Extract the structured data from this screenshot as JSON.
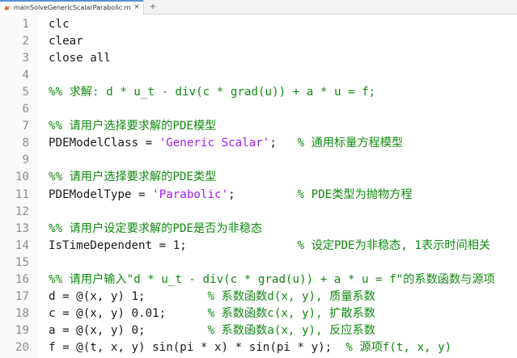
{
  "tab": {
    "title": "mainSolveGenericScalarParabolic.m",
    "close_glyph": "×",
    "add_glyph": "+"
  },
  "colors": {
    "comment": "#128a12",
    "string": "#a020f0",
    "text": "#1a1a1a",
    "line_number": "#8c8c8c",
    "tab_accent": "#5b8fd6"
  },
  "icons": {
    "file": "matlab-file-icon"
  },
  "lines": [
    {
      "num": "1",
      "code": "clc",
      "string": "",
      "rest": "",
      "comment": ""
    },
    {
      "num": "2",
      "code": "clear",
      "string": "",
      "rest": "",
      "comment": ""
    },
    {
      "num": "3",
      "code": "close all",
      "string": "",
      "rest": "",
      "comment": ""
    },
    {
      "num": "4",
      "code": "",
      "string": "",
      "rest": "",
      "comment": ""
    },
    {
      "num": "5",
      "code": "",
      "string": "",
      "rest": "",
      "comment": "%% 求解: d * u_t - div(c * grad(u)) + a * u = f;"
    },
    {
      "num": "6",
      "code": "",
      "string": "",
      "rest": "",
      "comment": ""
    },
    {
      "num": "7",
      "code": "",
      "string": "",
      "rest": "",
      "comment": "%% 请用户选择要求解的PDE模型"
    },
    {
      "num": "8",
      "code": "PDEModelClass = ",
      "string": "'Generic Scalar'",
      "rest": ";   ",
      "comment": "% 通用标量方程模型"
    },
    {
      "num": "9",
      "code": "",
      "string": "",
      "rest": "",
      "comment": ""
    },
    {
      "num": "10",
      "code": "",
      "string": "",
      "rest": "",
      "comment": "%% 请用户选择要求解的PDE类型"
    },
    {
      "num": "11",
      "code": "PDEModelType = ",
      "string": "'Parabolic'",
      "rest": ";         ",
      "comment": "% PDE类型为抛物方程"
    },
    {
      "num": "12",
      "code": "",
      "string": "",
      "rest": "",
      "comment": ""
    },
    {
      "num": "13",
      "code": "",
      "string": "",
      "rest": "",
      "comment": "%% 请用户设定要求解的PDE是否为非稳态"
    },
    {
      "num": "14",
      "code": "IsTimeDependent = 1;                ",
      "string": "",
      "rest": "",
      "comment": "% 设定PDE为非稳态, 1表示时间相关"
    },
    {
      "num": "15",
      "code": "",
      "string": "",
      "rest": "",
      "comment": ""
    },
    {
      "num": "16",
      "code": "",
      "string": "",
      "rest": "",
      "comment": "%% 请用户输入\"d * u_t - div(c * grad(u)) + a * u = f\"的系数函数与源项"
    },
    {
      "num": "17",
      "code": "d = @(x, y) 1;         ",
      "string": "",
      "rest": "",
      "comment": "% 系数函数d(x, y), 质量系数"
    },
    {
      "num": "18",
      "code": "c = @(x, y) 0.01;      ",
      "string": "",
      "rest": "",
      "comment": "% 系数函数c(x, y), 扩散系数"
    },
    {
      "num": "19",
      "code": "a = @(x, y) 0;         ",
      "string": "",
      "rest": "",
      "comment": "% 系数函数a(x, y), 反应系数"
    },
    {
      "num": "20",
      "code": "f = @(t, x, y) sin(pi * x) * sin(pi * y);  ",
      "string": "",
      "rest": "",
      "comment": "% 源项f(t, x, y)"
    }
  ]
}
